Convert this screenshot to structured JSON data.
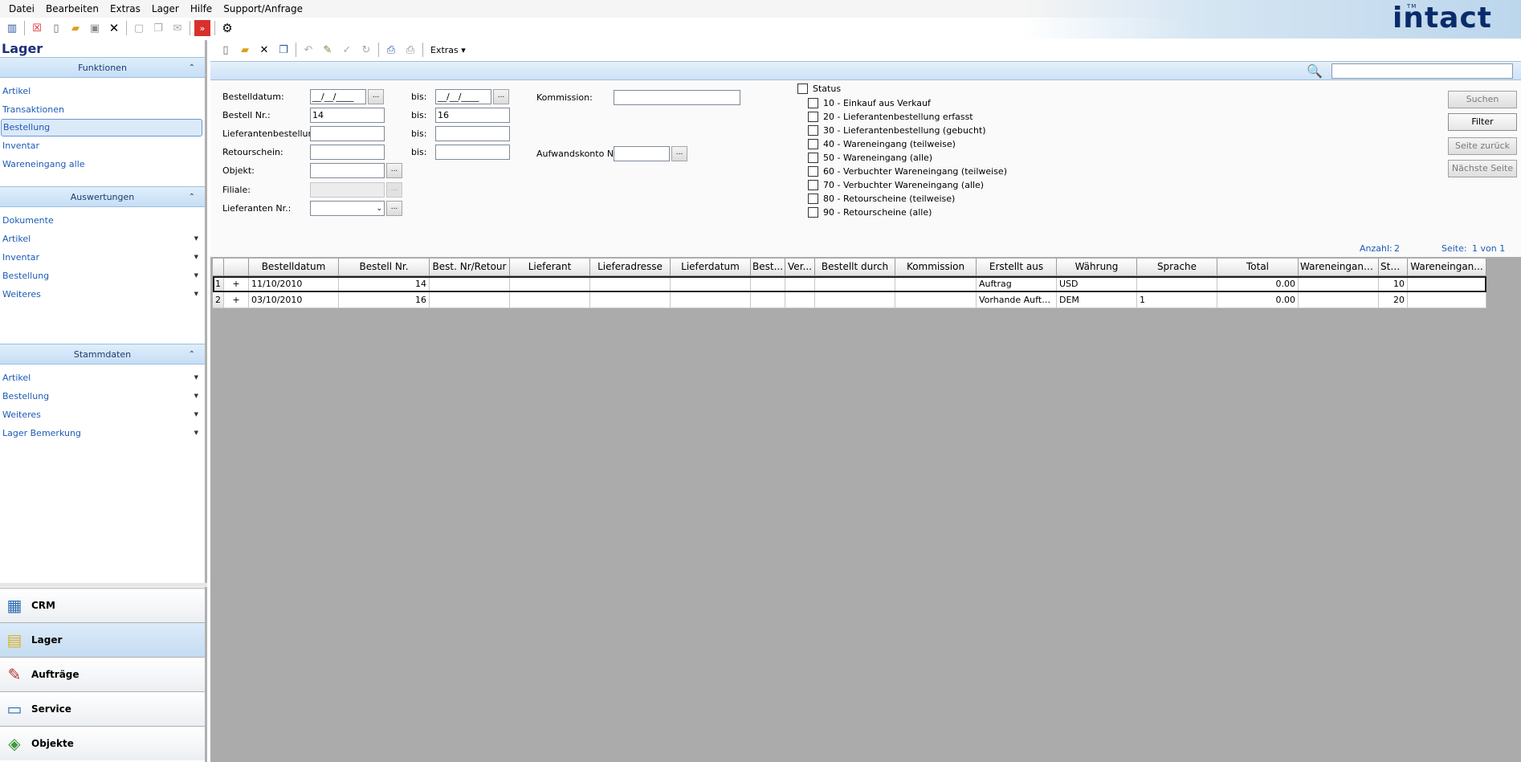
{
  "menu": [
    "Datei",
    "Bearbeiten",
    "Extras",
    "Lager",
    "Hilfe",
    "Support/Anfrage"
  ],
  "logo": {
    "text": "intact",
    "tm": "TM"
  },
  "left": {
    "title": "Lager",
    "sections": [
      {
        "label": "Funktionen",
        "items": [
          {
            "label": "Artikel",
            "dropdown": false
          },
          {
            "label": "Transaktionen",
            "dropdown": false
          },
          {
            "label": "Bestellung",
            "dropdown": false,
            "selected": true
          },
          {
            "label": "Inventar",
            "dropdown": false
          },
          {
            "label": "Wareneingang alle",
            "dropdown": false
          }
        ]
      },
      {
        "label": "Auswertungen",
        "items": [
          {
            "label": "Dokumente",
            "dropdown": false
          },
          {
            "label": "Artikel",
            "dropdown": true
          },
          {
            "label": "Inventar",
            "dropdown": true
          },
          {
            "label": "Bestellung",
            "dropdown": true
          },
          {
            "label": "Weiteres",
            "dropdown": true
          }
        ]
      },
      {
        "label": "Stammdaten",
        "items": [
          {
            "label": "Artikel",
            "dropdown": true
          },
          {
            "label": "Bestellung",
            "dropdown": true
          },
          {
            "label": "Weiteres",
            "dropdown": true
          },
          {
            "label": "Lager Bemerkung",
            "dropdown": true
          }
        ]
      }
    ],
    "nav": [
      {
        "label": "CRM",
        "icon": "crm-icon",
        "active": false
      },
      {
        "label": "Lager",
        "icon": "lager-icon",
        "active": true
      },
      {
        "label": "Aufträge",
        "icon": "auftraege-icon",
        "active": false
      },
      {
        "label": "Service",
        "icon": "service-icon",
        "active": false
      },
      {
        "label": "Objekte",
        "icon": "objekte-icon",
        "active": false
      }
    ]
  },
  "toolbar2": {
    "extras": "Extras"
  },
  "form": {
    "bestelldatum_label": "Bestelldatum:",
    "bestelldatum_from": "__/__/____",
    "bestelldatum_to": "__/__/____",
    "bis": "bis:",
    "bestellnr_label": "Bestell Nr.:",
    "bestellnr_from": "14",
    "bestellnr_to": "16",
    "lieferantenbestellung_label": "Lieferantenbestellung",
    "retourschein_label": "Retourschein:",
    "objekt_label": "Objekt:",
    "filiale_label": "Filiale:",
    "lieferanten_label": "Lieferanten Nr.:",
    "kommission_label": "Kommission:",
    "aufwandskonto_label": "Aufwandskonto Nr.:",
    "dots": "...",
    "status_label": "Status",
    "status_options": [
      "10 - Einkauf aus Verkauf",
      "20 - Lieferantenbestellung erfasst",
      "30 - Lieferantenbestellung (gebucht)",
      "40 - Wareneingang (teilweise)",
      "50 - Wareneingang (alle)",
      "60 - Verbuchter Wareneingang (teilweise)",
      "70 - Verbuchter Wareneingang (alle)",
      "80 - Retourscheine (teilweise)",
      "90 - Retourscheine (alle)"
    ],
    "buttons": {
      "suchen": "Suchen",
      "filter": "Filter",
      "zurueck": "Seite zurück",
      "naechste": "Nächste Seite"
    },
    "anzahl_label": "Anzahl:",
    "anzahl_value": "2",
    "seite_label": "Seite:",
    "seite_value": "1 von 1"
  },
  "grid": {
    "columns": [
      "",
      "",
      "Bestelldatum",
      "Bestell Nr.",
      "Best. Nr/Retour",
      "Lieferant",
      "Lieferadresse",
      "Lieferdatum",
      "Best...",
      "Ver...",
      "Bestellt durch",
      "Kommission",
      "Erstellt aus",
      "Währung",
      "Sprache",
      "Total",
      "Wareneingangs...",
      "Sta...",
      "Wareneingan..."
    ],
    "rows": [
      [
        "1",
        "+",
        "11/10/2010",
        "14",
        "",
        "",
        "",
        "",
        "",
        "",
        "",
        "",
        "Auftrag",
        "USD",
        "",
        "0.00",
        "",
        "10",
        ""
      ],
      [
        "2",
        "+",
        "03/10/2010",
        "16",
        "",
        "",
        "",
        "",
        "",
        "",
        "",
        "",
        "Vorhande Aufträ...",
        "DEM",
        "1",
        "0.00",
        "",
        "20",
        ""
      ]
    ]
  }
}
